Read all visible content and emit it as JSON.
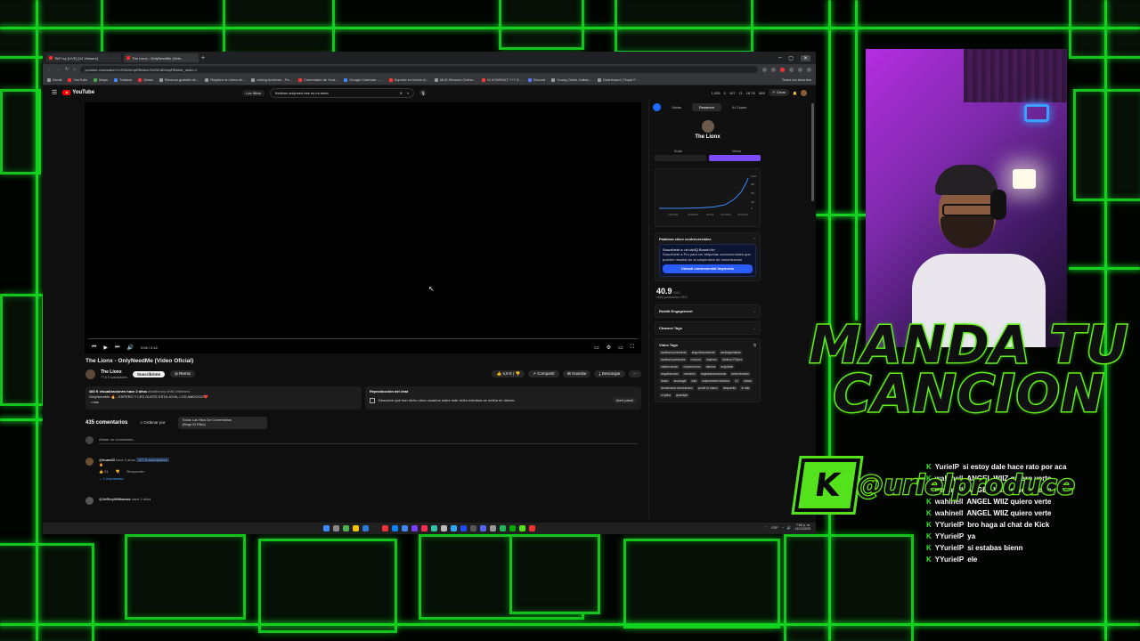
{
  "browser": {
    "tabs": [
      {
        "label": "TikFi ky [LIVE] [14 Viewers]"
      },
      {
        "label": "The Lionx - OnlyNeedMe (Vide..."
      }
    ],
    "url": "youtube.com/watch?v=f5SdUmpRBbtsd=5U9tCdEkmpRBbtsrt_radio=1",
    "bookmarks": [
      "Gmail",
      "YouTube",
      "Maps",
      "Traducir",
      "Music",
      "Recurso gratuito de...",
      "Registro en línea de...",
      "mixing Archives - Pa...",
      "Comentario de Yout...",
      "Google Calendar - ...",
      "Soporte en forma di...",
      "MLB Streams Online...",
      "M KOMPAKT 7+7-3...",
      "Discord",
      "Young Ozbei, Italian...",
      "Dashboard | Royal F..."
    ],
    "bookmarks_end": "Todos los favoritos"
  },
  "youtube": {
    "logo": "YouTube",
    "filters": "Los filtros",
    "search_query": "thelionx onlyneed ese es mi tema",
    "stats": [
      "1,006",
      "0",
      "167",
      "11",
      "18.7K",
      "669"
    ],
    "create": "Crear",
    "time": "0:06 / 2:42",
    "video_title": "The Lionx - OnlyNeedMe (Video Oficial)",
    "channel_name": "The Lionx",
    "channel_subs": "77,6 K suscriptores",
    "subscribe": "Suscribirme",
    "remix": "Remix",
    "likes": "4,8 K",
    "share": "Compartir",
    "save": "Guardar",
    "download": "Descargar",
    "desc_stats": "483 K visualizaciones  hace 2 años",
    "desc_tags": "#badbunny #rdt2 #thelionx",
    "desc_text": "OnlyNeedMe 🔥 - ESPERO Y LES GUSTE ESTA JOYA, LOS AMOOOO❤️",
    "desc_more": "...más",
    "chat_title": "Reproducción del chat",
    "chat_text": "Descubre qué han dicho otros usuarios sobre este video mientras se emitía en directo.",
    "chat_open": "Abrir panel",
    "comments_count": "435 comentarios",
    "sort": "Ordenar por",
    "filter_line1": "Todos Los Hilos De Comentarios",
    "filter_line2": "(Elegir El Filtro)",
    "add_comment": "Añadir un comentario...",
    "comments": [
      {
        "user": "@huan63",
        "meta": "hace 2 años",
        "tag": "127,9 suscriptores",
        "text": "🔥",
        "likes": "31",
        "reply": "Responder",
        "replies": "2 respuestas"
      },
      {
        "user": "@JeffreyWilliamsa",
        "meta": "hace 2 años",
        "text": "",
        "likes": "",
        "reply": "",
        "replies": ""
      }
    ]
  },
  "vidiq": {
    "tabs": [
      "Vistas",
      "Resumen",
      "AI Coach"
    ],
    "channel": "The Lionx",
    "toggle": [
      "Subs",
      "Views"
    ],
    "graph_y": [
      "10M",
      "8M",
      "5M",
      "3M",
      "0"
    ],
    "graph_x": [
      "12/14/21",
      "10/05/22",
      "9/7/23",
      "10/23/24",
      "10/14/25"
    ],
    "controversial_title": "Palabras clave controversiales",
    "promo_head": "Suscríbete a <b>vidIQ Boost</b>",
    "promo_text": "Suscríbete a Pro para ver etiquetas controversiales que pueden resultar en la suspensión de monetización",
    "unlock": "Unlock controversial keywords",
    "score": "40.9",
    "score_unit": "/100",
    "score_label": "vidIQ puntuación SEO",
    "reddit": "Reddit Engagement",
    "channel_tags": "Channel Tags",
    "video_tags": "Video Tags",
    "tags": [
      "badbunnyconcierto",
      "anguilloaccidente",
      "santiagomatias",
      "badbunnyneworks",
      "rochyrd",
      "traylorm",
      "thelionx700pre",
      "eladiocarrion",
      "mykemovers",
      "takicha",
      "anguildar",
      "anguildorado",
      "mooterio",
      "anguilaeclusuoorta",
      "bebeobrotolo",
      "drako",
      "anuangel",
      "bad",
      "onlyneedme thelionx",
      "#1",
      "oficial",
      "dominicano dominicano",
      "yoviel el malvo",
      "despacito",
      "el alfa",
      "el yaba",
      "gluestylo"
    ]
  },
  "taskbar": {
    "lang": "ESP",
    "time": "7:50 p. m.",
    "date": "14/11/2025"
  },
  "overlay": {
    "title_line1": "MANDA TU",
    "title_line2": "CANCION",
    "badge": "K",
    "handle": "@urielproduce"
  },
  "chat": [
    {
      "user": "YurielP",
      "text": "si estoy dale hace rato por aca"
    },
    {
      "user": "wahinell",
      "text": "ANGEL WIIZ quiero verte"
    },
    {
      "user": "wahinell",
      "text": "ANGEL WIIZ quiero verte"
    },
    {
      "user": "wahinell",
      "text": "ANGEL WIIZ quiero verte"
    },
    {
      "user": "wahinell",
      "text": "ANGEL WIIZ quiero verte"
    },
    {
      "user": "YYurielP",
      "text": "bro haga al chat de Kick"
    },
    {
      "user": "YYurielP",
      "text": "ya"
    },
    {
      "user": "YYurielP",
      "text": "si estabas bienn"
    },
    {
      "user": "YYurielP",
      "text": "ele"
    }
  ],
  "colors": {
    "neon": "#13d11e",
    "yt_red": "#ff0000",
    "vidiq_purple": "#7b4cff",
    "kick_green": "#53e21b"
  }
}
